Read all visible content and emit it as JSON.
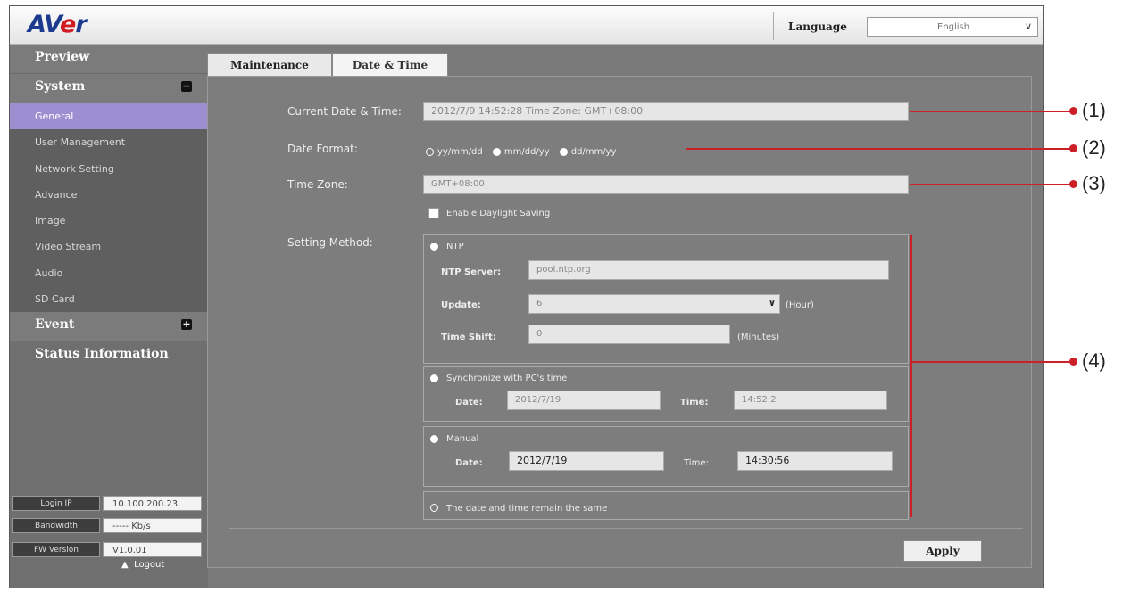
{
  "header": {
    "logo_prefix": "AV",
    "logo_e": "e",
    "logo_suffix": "r",
    "language_label": "Language",
    "language_value": "English"
  },
  "sidebar": {
    "preview": "Preview",
    "system": "System",
    "system_toggle": "−",
    "system_items": [
      "General",
      "User Management",
      "Network Setting",
      "Advance",
      "Image",
      "Video Stream",
      "Audio",
      "SD Card"
    ],
    "event": "Event",
    "event_toggle": "+",
    "status_information": "Status Information",
    "login_ip_label": "Login IP",
    "login_ip_value": "10.100.200.23",
    "bandwidth_label": "Bandwidth",
    "bandwidth_value": "----- Kb/s",
    "fw_label": "FW Version",
    "fw_value": "V1.0.01",
    "logout": "Logout"
  },
  "tabs": {
    "maintenance": "Maintenance",
    "date_time": "Date & Time"
  },
  "form": {
    "current_dt_label": "Current Date & Time:",
    "current_dt_value": "2012/7/9 14:52:28 Time Zone: GMT+08:00",
    "date_format_label": "Date Format:",
    "date_formats": [
      "yy/mm/dd",
      "mm/dd/yy",
      "dd/mm/yy"
    ],
    "time_zone_label": "Time Zone:",
    "time_zone_value": "GMT+08:00",
    "daylight_label": "Enable Daylight Saving",
    "setting_method_label": "Setting Method:",
    "ntp_label": "NTP",
    "ntp_server_label": "NTP Server:",
    "ntp_server_value": "pool.ntp.org",
    "update_label": "Update:",
    "update_value": "6",
    "update_unit": "(Hour)",
    "time_shift_label": "Time Shift:",
    "time_shift_value": "0",
    "time_shift_unit": "(Minutes)",
    "sync_label": "Synchronize with PC's time",
    "sync_date_label": "Date:",
    "sync_date_value": "2012/7/19",
    "sync_time_label": "Time:",
    "sync_time_value": "14:52:2",
    "manual_label": "Manual",
    "manual_date_label": "Date:",
    "manual_date_value": "2012/7/19",
    "manual_time_label": "Time:",
    "manual_time_value": "14:30:56",
    "remain_label": "The date and time remain the same",
    "apply": "Apply"
  },
  "callouts": [
    "(1)",
    "(2)",
    "(3)",
    "(4)"
  ],
  "colors": {
    "callout": "#cc1f27",
    "active_nav": "#9c8ed0",
    "logo_blue": "#1c3b8f",
    "logo_red": "#d11a22"
  }
}
